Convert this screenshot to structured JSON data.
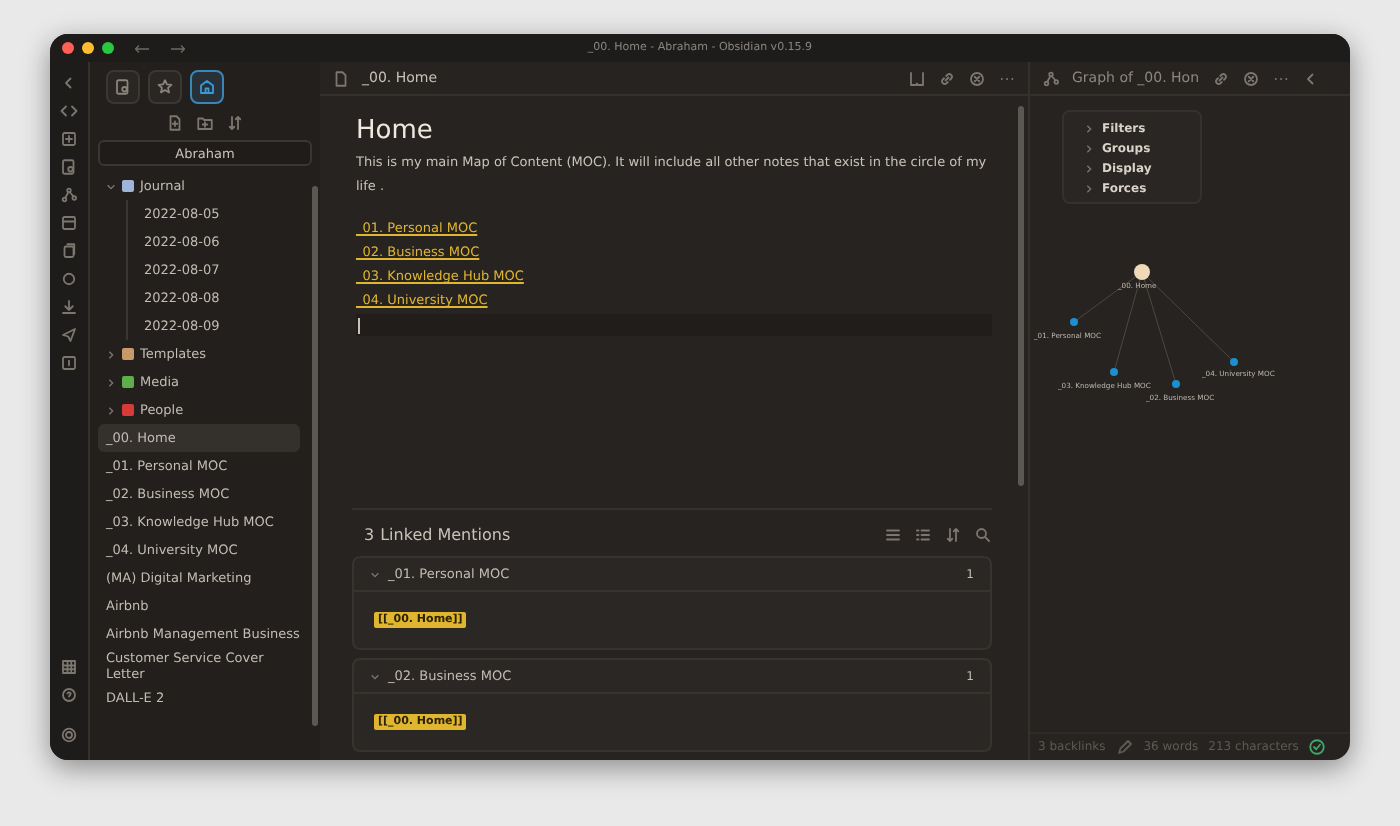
{
  "window": {
    "title": "_00. Home - Abraham - Obsidian v0.15.9"
  },
  "sidebar_tabs": [
    {
      "kind": "search",
      "selected": false
    },
    {
      "kind": "star",
      "selected": false
    },
    {
      "kind": "home",
      "selected": true
    }
  ],
  "vault": {
    "name": "Abraham"
  },
  "files": [
    {
      "name": "Journal",
      "kind": "folder",
      "expanded": true,
      "color": "#9fb4d8",
      "selected": false,
      "children": [
        {
          "name": "2022-08-05",
          "selected": false
        },
        {
          "name": "2022-08-06",
          "selected": false
        },
        {
          "name": "2022-08-07",
          "selected": false
        },
        {
          "name": "2022-08-08",
          "selected": false
        },
        {
          "name": "2022-08-09",
          "selected": false
        }
      ]
    },
    {
      "name": "Templates",
      "kind": "folder",
      "expanded": false,
      "color": "#c89a6a",
      "selected": false
    },
    {
      "name": "Media",
      "kind": "folder",
      "expanded": false,
      "color": "#5fae4c",
      "selected": false
    },
    {
      "name": "People",
      "kind": "folder",
      "expanded": false,
      "color": "#d83a3a",
      "selected": false
    },
    {
      "name": "_00. Home",
      "selected": true
    },
    {
      "name": "_01. Personal MOC",
      "selected": false
    },
    {
      "name": "_02. Business MOC",
      "selected": false
    },
    {
      "name": "_03. Knowledge Hub MOC",
      "selected": false
    },
    {
      "name": "_04. University MOC",
      "selected": false
    },
    {
      "name": "(MA) Digital Marketing",
      "selected": false
    },
    {
      "name": "Airbnb",
      "selected": false
    },
    {
      "name": "Airbnb Management Business",
      "selected": false
    },
    {
      "name": "Customer Service Cover Letter",
      "selected": false
    },
    {
      "name": "DALL-E 2",
      "selected": false
    }
  ],
  "editor": {
    "tab_title": "_00. Home",
    "heading": "Home",
    "paragraph": "This is my main Map of Content (MOC). It will include all other notes that exist in the circle of my life .",
    "links": [
      "_01. Personal MOC",
      "_02. Business MOC",
      "_03. Knowledge Hub MOC",
      "_04. University MOC"
    ]
  },
  "linked_mentions": {
    "count": "3",
    "label": "Linked Mentions",
    "items": [
      {
        "title": "_01. Personal MOC",
        "count": "1",
        "expanded": true,
        "snippet": "[[_00. Home]]"
      },
      {
        "title": "_02. Business MOC",
        "count": "1",
        "expanded": true,
        "snippet": "[[_00. Home]]"
      }
    ]
  },
  "graph": {
    "tab_title": "Graph of _00. Hon",
    "settings": [
      {
        "label": "Filters",
        "expanded": false
      },
      {
        "label": "Groups",
        "expanded": false
      },
      {
        "label": "Display",
        "expanded": false
      },
      {
        "label": "Forces",
        "expanded": false
      }
    ],
    "nodes": [
      {
        "label": "_00. Home",
        "kind": "center"
      },
      {
        "label": "_01. Personal MOC",
        "kind": "link"
      },
      {
        "label": "_03. Knowledge Hub MOC",
        "kind": "link"
      },
      {
        "label": "_02. Business MOC",
        "kind": "link"
      },
      {
        "label": "_04. University MOC",
        "kind": "link"
      }
    ]
  },
  "status_bar": {
    "backlinks": "3 backlinks",
    "words": "36 words",
    "characters": "213 characters"
  }
}
